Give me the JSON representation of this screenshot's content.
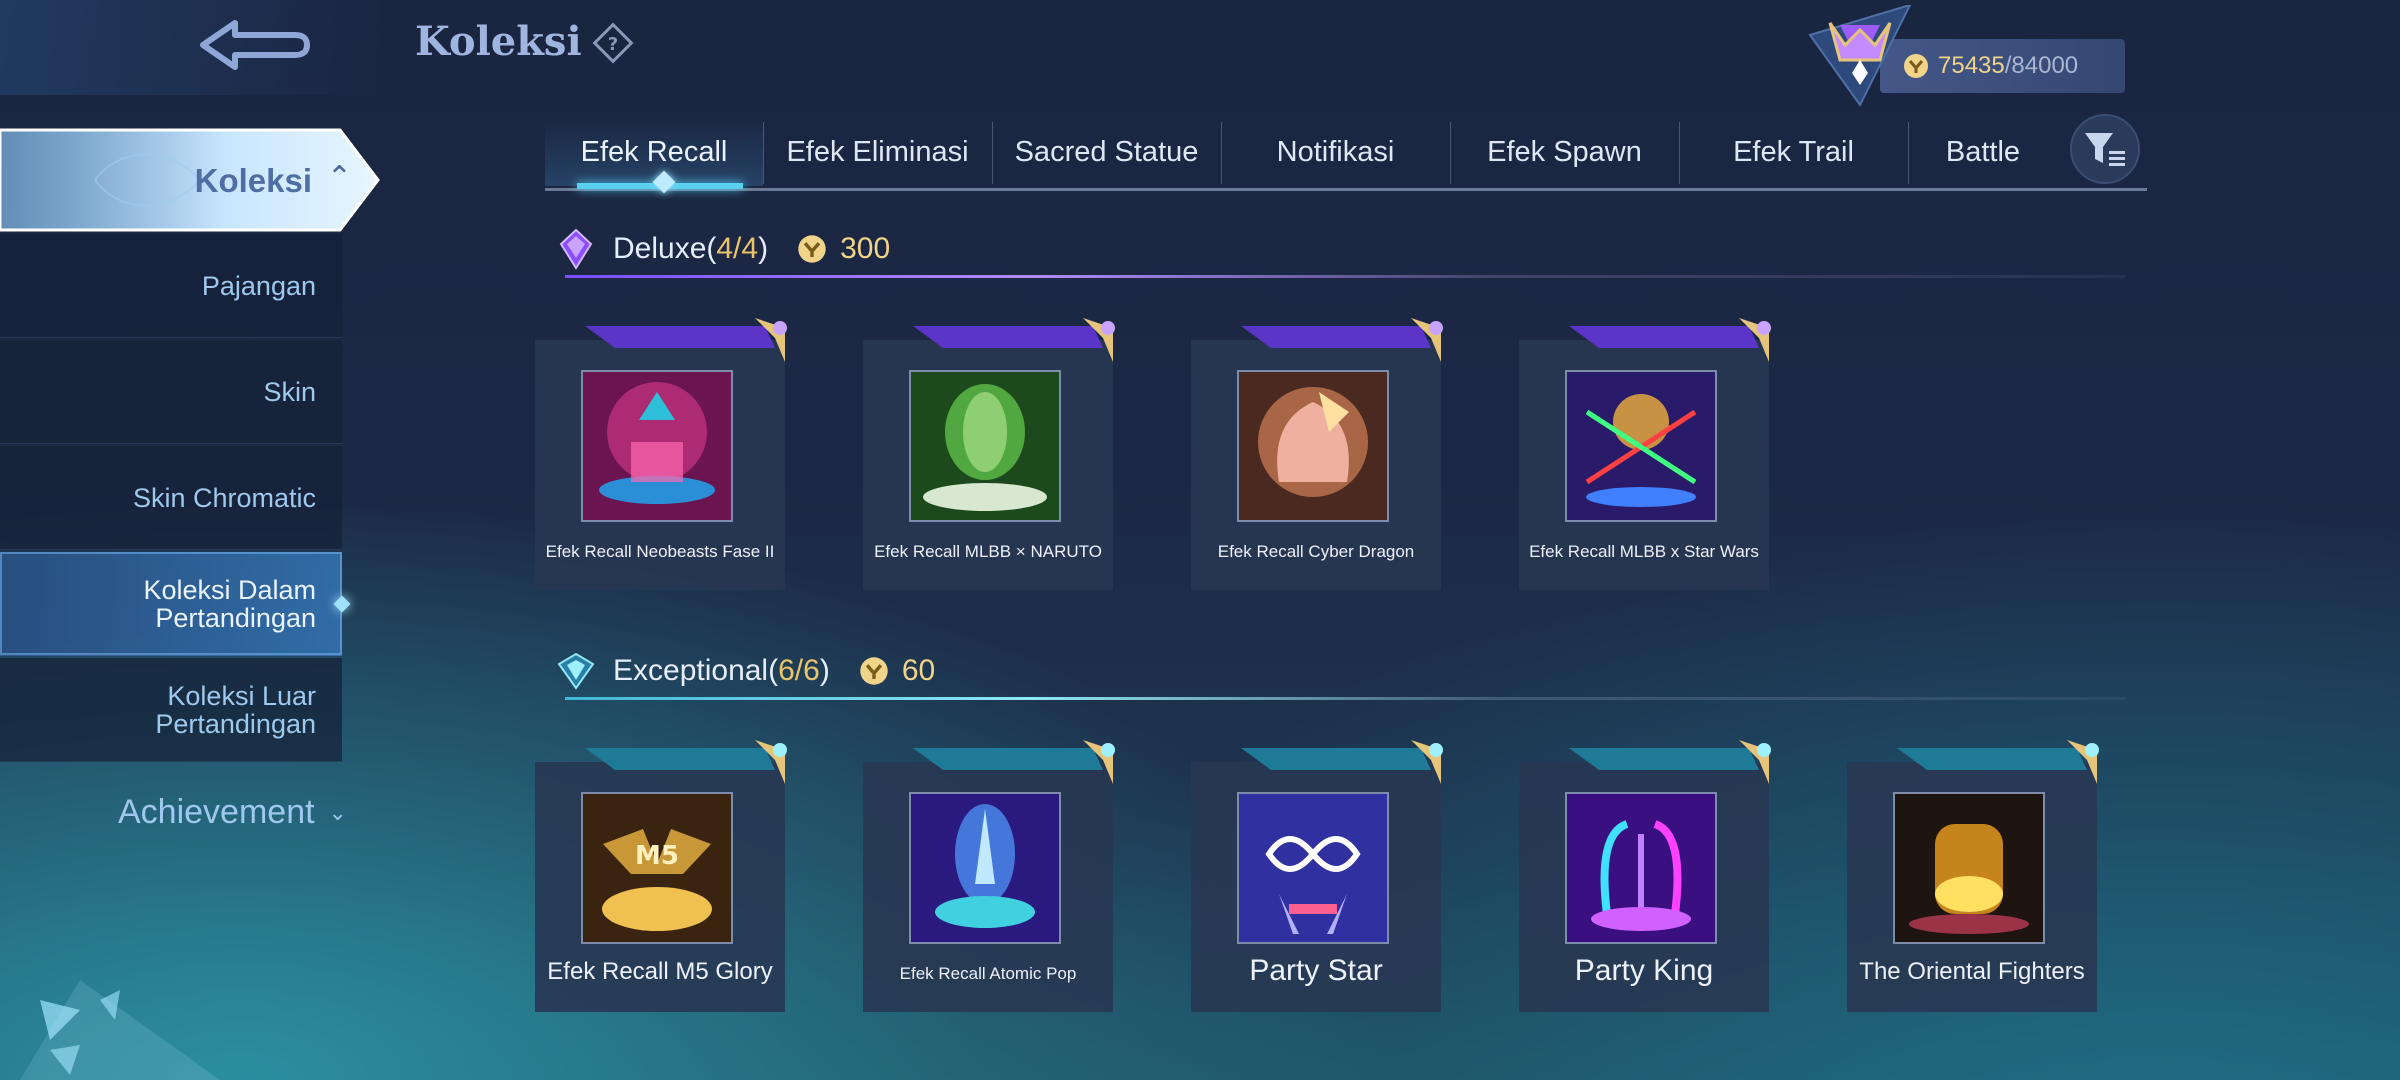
{
  "header": {
    "title": "Koleksi"
  },
  "currency": {
    "value": "75435",
    "max": "/84000"
  },
  "sidebar": {
    "top_label": "Koleksi",
    "items": [
      {
        "label": "Pajangan"
      },
      {
        "label": "Skin"
      },
      {
        "label": "Skin Chromatic"
      },
      {
        "label": "Koleksi Dalam Pertandingan",
        "active": true
      },
      {
        "label": "Koleksi Luar Pertandingan"
      }
    ],
    "achievement": "Achievement"
  },
  "tabs": [
    {
      "label": "Efek Recall",
      "active": true
    },
    {
      "label": "Efek Eliminasi"
    },
    {
      "label": "Sacred Statue"
    },
    {
      "label": "Notifikasi"
    },
    {
      "label": "Efek Spawn"
    },
    {
      "label": "Efek Trail"
    },
    {
      "label": "Battle"
    }
  ],
  "sections": [
    {
      "name": "Deluxe(",
      "count": "4/4",
      "close": ")",
      "price": "300",
      "accent": "#9b5cff",
      "items": [
        {
          "label": "Efek Recall Neobeasts Fase II"
        },
        {
          "label": "Efek Recall MLBB × NARUTO"
        },
        {
          "label": "Efek Recall Cyber Dragon"
        },
        {
          "label": "Efek Recall MLBB x Star Wars"
        }
      ]
    },
    {
      "name": "Exceptional(",
      "count": "6/6",
      "close": ")",
      "price": "60",
      "accent": "#4fd6e6",
      "items": [
        {
          "label": "Efek Recall M5 Glory"
        },
        {
          "label": "Efek Recall Atomic Pop"
        },
        {
          "label": "Party Star"
        },
        {
          "label": "Party King"
        },
        {
          "label": "The Oriental Fighters"
        }
      ]
    }
  ]
}
